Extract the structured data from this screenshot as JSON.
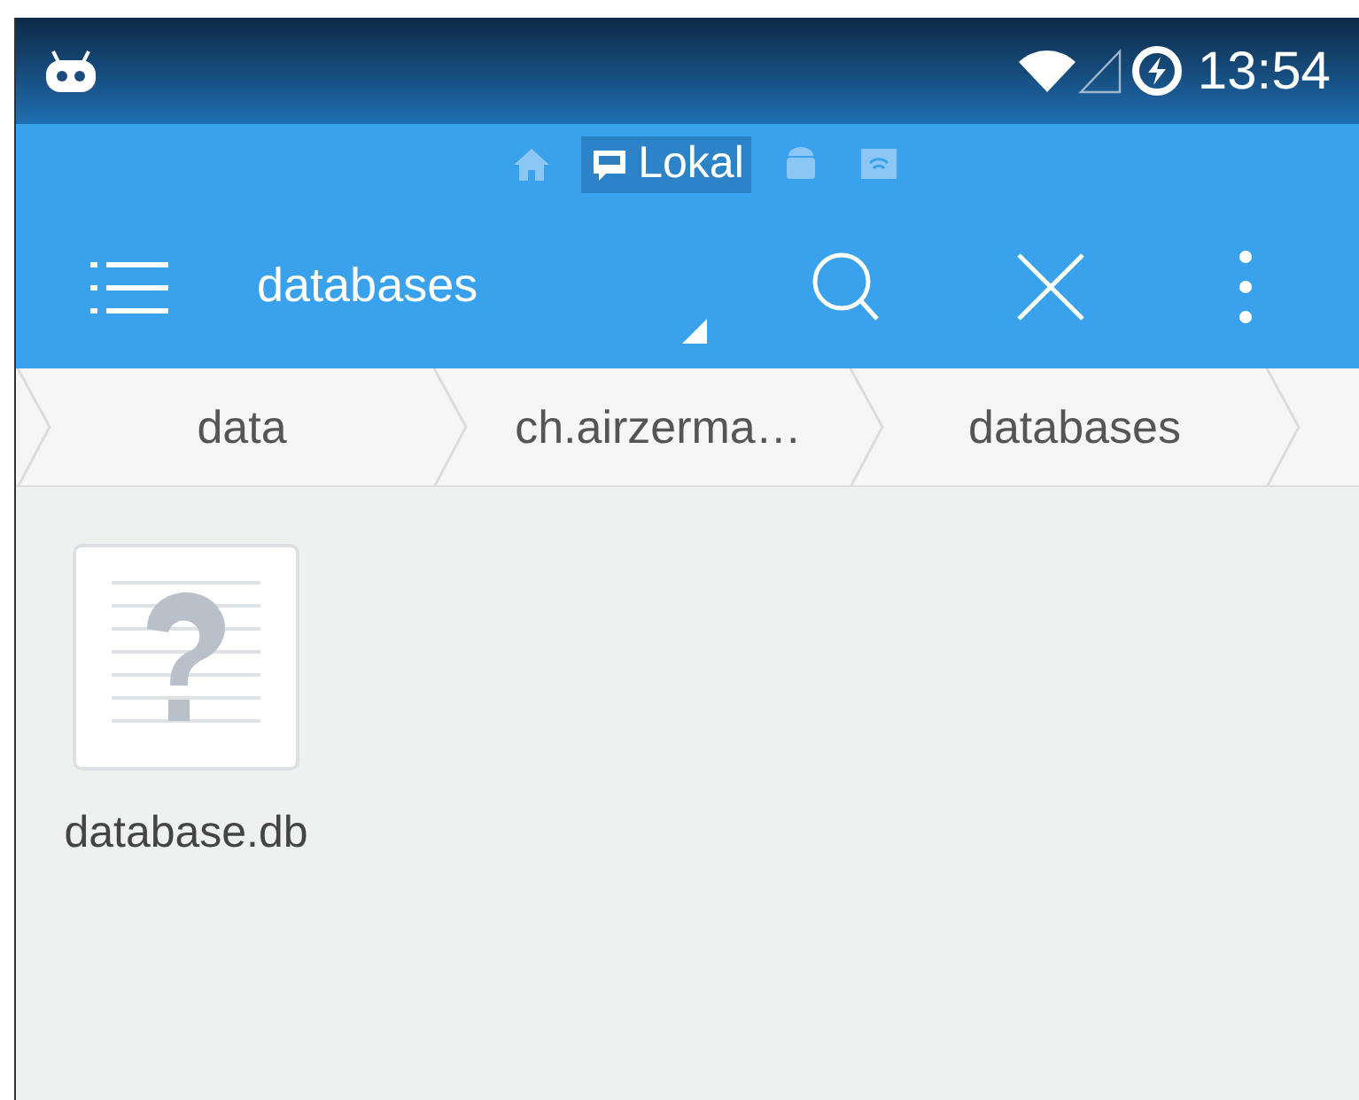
{
  "status_bar": {
    "time": "13:54"
  },
  "locations": [
    {
      "kind": "home",
      "selected": false
    },
    {
      "kind": "sdcard",
      "label": "Lokal",
      "selected": true
    },
    {
      "kind": "android",
      "selected": false
    },
    {
      "kind": "network",
      "selected": false
    }
  ],
  "toolbar": {
    "title": "databases"
  },
  "breadcrumbs": [
    "data",
    "ch.airzerma…",
    "databases"
  ],
  "files": [
    {
      "name": "database.db",
      "kind": "unknown"
    }
  ]
}
